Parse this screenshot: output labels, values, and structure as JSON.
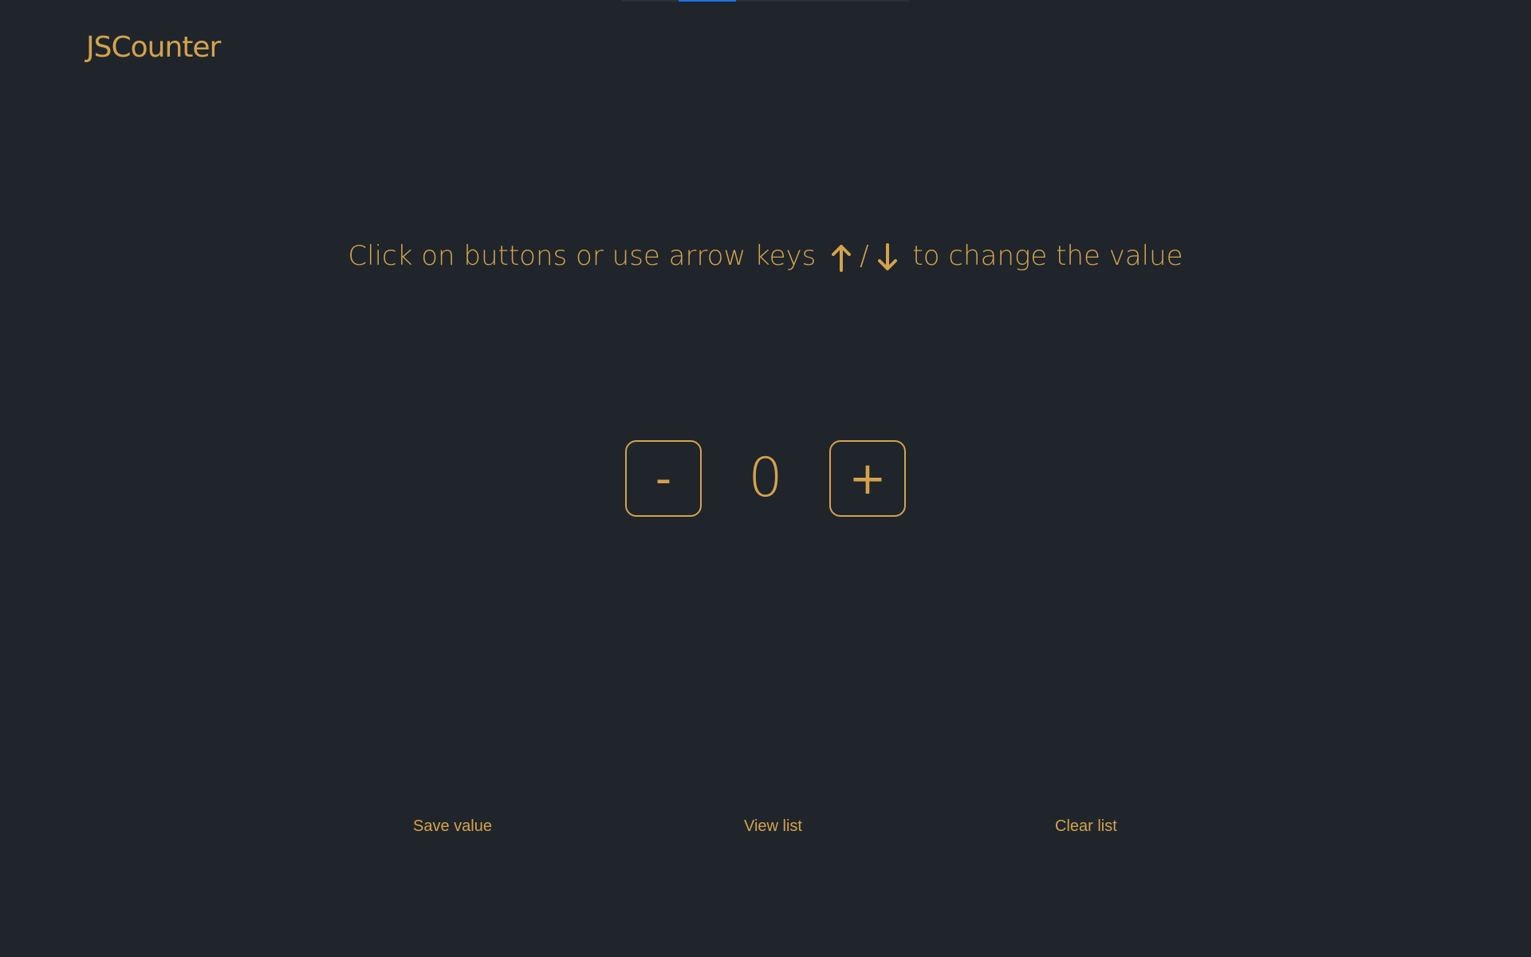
{
  "app": {
    "title": "JSCounter",
    "accent_color": "#d4a24c",
    "background_color": "#1f252b"
  },
  "instructions": {
    "before": "Click on buttons or use arrow keys",
    "slash": "/",
    "after": "to change the value",
    "up_icon": "arrow-up-icon",
    "down_icon": "arrow-down-icon"
  },
  "counter": {
    "decrement_label": "-",
    "value": "0",
    "increment_label": "+"
  },
  "actions": {
    "save_label": "Save value",
    "view_label": "View list",
    "clear_label": "Clear list"
  }
}
